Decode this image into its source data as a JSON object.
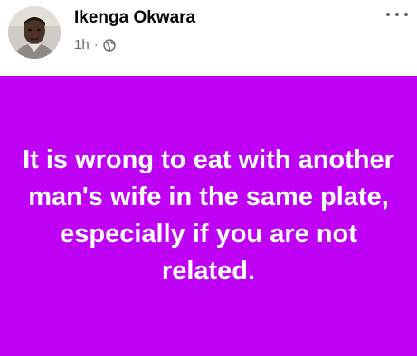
{
  "post": {
    "author": {
      "name": "Ikenga Okwara"
    },
    "timestamp": "1h",
    "separator": "·",
    "audience_icon": "globe-icon",
    "more_icon": "more-horizontal-icon",
    "status_text": "It is wrong to eat with another man's wife in the same plate, especially if you are not related.",
    "colors": {
      "background": "#BF02F5",
      "text": "#FFFFFF",
      "name": "#050505",
      "meta": "#65676B"
    }
  }
}
